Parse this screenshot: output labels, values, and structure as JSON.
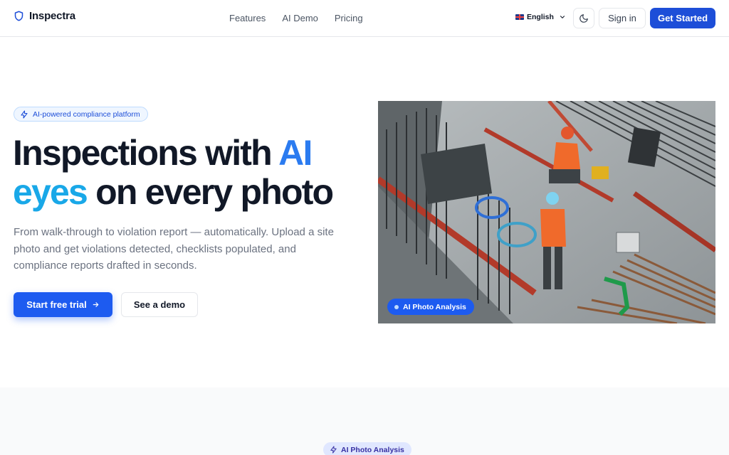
{
  "brand": {
    "name": "Inspectra"
  },
  "nav": {
    "features": "Features",
    "ai_demo": "AI Demo",
    "pricing": "Pricing"
  },
  "header": {
    "language": "English",
    "sign_in": "Sign in",
    "get_started": "Get Started"
  },
  "hero": {
    "badge": "AI-powered compliance platform",
    "headline_part1": "Inspections with ",
    "headline_ai": "AI",
    "headline_eyes": "eyes",
    "headline_part2": " on every photo",
    "subtitle": "From walk-through to violation report — automatically. Upload a site photo and get violations detected, checklists populated, and compliance reports drafted in seconds.",
    "cta_primary": "Start free trial",
    "cta_secondary": "See a demo",
    "photo_label": "AI Photo Analysis"
  },
  "section2": {
    "pill": "AI Photo Analysis"
  },
  "icons": {
    "brand": "shield-icon",
    "badge": "lightning-icon",
    "theme": "moon-icon",
    "language": "chevron-down-icon",
    "cta": "arrow-right-icon"
  },
  "colors": {
    "primary": "#1d4ed8",
    "accent_ai": "#2b7bf0",
    "accent_eyes": "#19a8e8",
    "text": "#111827",
    "muted": "#6b7280"
  }
}
